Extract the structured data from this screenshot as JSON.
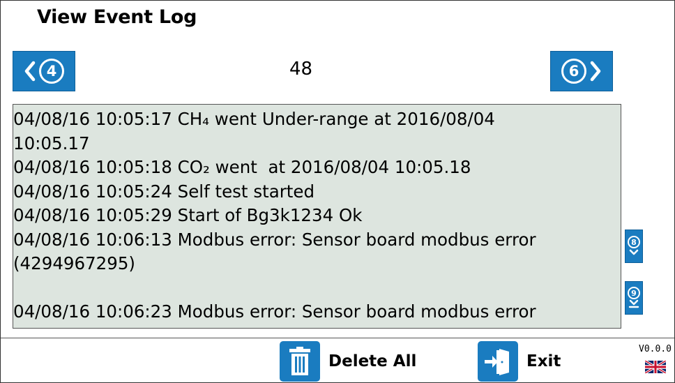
{
  "header": {
    "title": "View Event Log"
  },
  "pager": {
    "prev_number": "4",
    "page_number": "48",
    "next_number": "6"
  },
  "log": {
    "lines": [
      "04/08/16 10:05:17 CH₄ went Under-range at 2016/08/04",
      "10:05.17",
      "04/08/16 10:05:18 CO₂ went  at 2016/08/04 10:05.18",
      "04/08/16 10:05:24 Self test started",
      "04/08/16 10:05:29 Start of Bg3k1234 Ok",
      "04/08/16 10:06:13 Modbus error: Sensor board modbus error",
      "(4294967295)",
      "",
      "04/08/16 10:06:23 Modbus error: Sensor board modbus error"
    ]
  },
  "scroll": {
    "down_number": "8",
    "bottom_number": "9"
  },
  "toolbar": {
    "delete_all_label": "Delete All",
    "exit_label": "Exit"
  },
  "status": {
    "version": "V0.0.0"
  },
  "colors": {
    "accent": "#1a7cc0",
    "log_background": "#dde5df"
  },
  "icons": {
    "prev": "chevron-left-icon",
    "next": "chevron-right-icon",
    "down": "chevron-down-icon",
    "bottom": "scroll-to-bottom-icon",
    "delete": "trash-icon",
    "exit": "exit-door-icon",
    "language": "uk-flag-icon"
  }
}
